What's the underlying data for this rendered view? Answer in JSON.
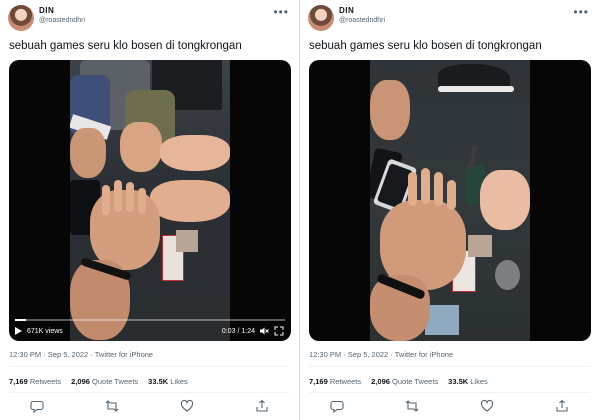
{
  "tweets": [
    {
      "author_name": "DIN",
      "handle": "@roastedndhri",
      "text": "sebuah games seru klo bosen di tongkrongan",
      "views": "671K views",
      "time": "0:03 / 1:24",
      "meta": "12:30 PM · Sep 5, 2022 · Twitter for iPhone",
      "retweets_count": "7,169",
      "retweets_label": "Retweets",
      "quotes_count": "2,096",
      "quotes_label": "Quote Tweets",
      "likes_count": "33.5K",
      "likes_label": "Likes"
    },
    {
      "author_name": "DIN",
      "handle": "@roastedndhri",
      "text": "sebuah games seru klo bosen di tongkrongan",
      "meta": "12:30 PM · Sep 5, 2022 · Twitter for iPhone",
      "retweets_count": "7,169",
      "retweets_label": "Retweets",
      "quotes_count": "2,096",
      "quotes_label": "Quote Tweets",
      "likes_count": "33.5K",
      "likes_label": "Likes"
    }
  ],
  "icons": {
    "more": "more-icon",
    "reply": "reply-icon",
    "retweet": "retweet-icon",
    "like": "like-icon",
    "share": "share-icon"
  },
  "video_progress": 0.04
}
